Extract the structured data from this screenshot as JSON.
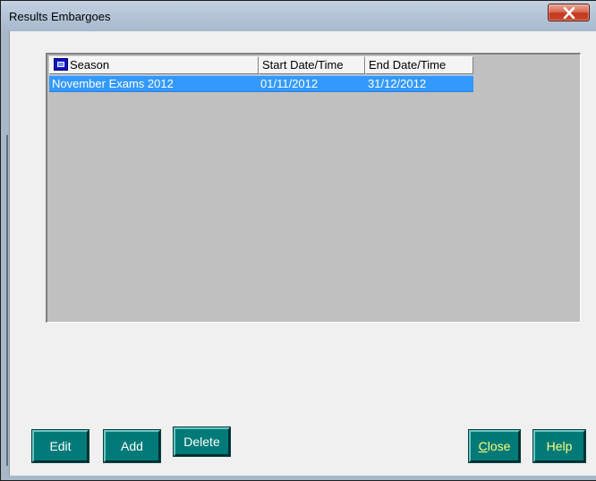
{
  "window": {
    "title": "Results Embargoes"
  },
  "list": {
    "columns": [
      "Season",
      "Start Date/Time",
      "End Date/Time"
    ],
    "rows": [
      {
        "season": "November Exams 2012",
        "start": "01/11/2012",
        "end": "31/12/2012",
        "selected": true
      }
    ],
    "selection_color": "#3399ff"
  },
  "buttons": {
    "edit": "Edit",
    "add": "Add",
    "delete": "Delete",
    "close_mnemonic": "C",
    "close_rest": "lose",
    "help": "Help"
  },
  "colors": {
    "button_bg": "#007a78",
    "list_bg": "#c0c0c0",
    "client_bg": "#f0f0f0"
  }
}
